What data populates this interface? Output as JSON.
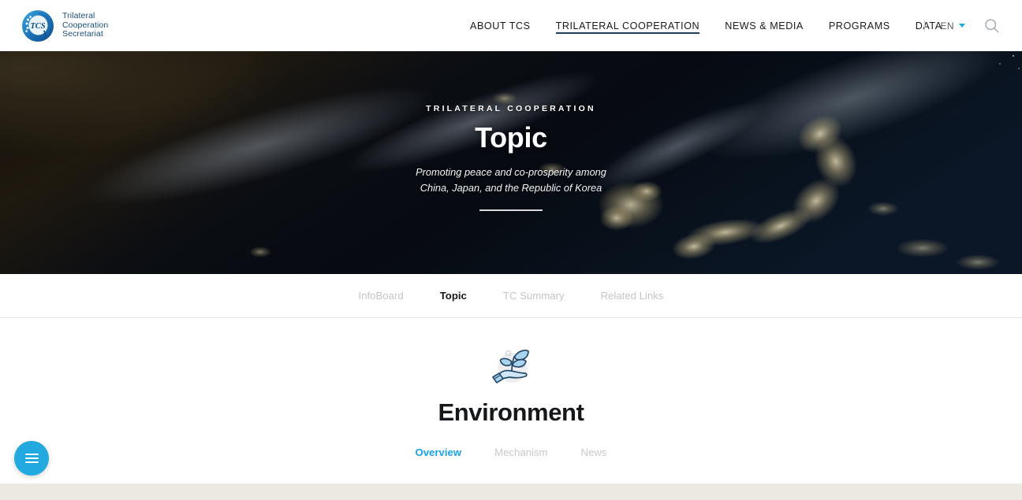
{
  "header": {
    "logo": {
      "icon": "tcs-globe-logo-icon",
      "line1": "Trilateral",
      "line2": "Cooperation",
      "line3": "Secretariat",
      "mark_text": "TCS"
    },
    "nav": [
      {
        "label": "ABOUT TCS",
        "active": false
      },
      {
        "label": "TRILATERAL COOPERATION",
        "active": true
      },
      {
        "label": "NEWS & MEDIA",
        "active": false
      },
      {
        "label": "PROGRAMS",
        "active": false
      },
      {
        "label": "DATA",
        "active": false
      }
    ],
    "language": {
      "label": "EN",
      "caret_icon": "chevron-down-icon"
    },
    "search": {
      "icon": "search-icon"
    },
    "accent_color": "#1aa9e0",
    "active_underline_color": "#1f3d5c"
  },
  "hero": {
    "eyebrow": "TRILATERAL COOPERATION",
    "title": "Topic",
    "subtitle_line1": "Promoting peace and co-prosperity among",
    "subtitle_line2": "China, Japan, and the Republic of Korea",
    "background": "earth-at-night-satellite-image"
  },
  "subnav": [
    {
      "label": "InfoBoard",
      "active": false
    },
    {
      "label": "Topic",
      "active": true
    },
    {
      "label": "TC Summary",
      "active": false
    },
    {
      "label": "Related Links",
      "active": false
    }
  ],
  "main": {
    "icon": "hand-holding-plant-icon",
    "title": "Environment",
    "tabs": [
      {
        "label": "Overview",
        "active": true
      },
      {
        "label": "Mechanism",
        "active": false
      },
      {
        "label": "News",
        "active": false
      }
    ],
    "active_tab_color": "#1aa3e8"
  },
  "fab": {
    "icon": "hamburger-menu-icon",
    "color": "#22a9e0"
  },
  "footer_strip": {
    "color": "#ebe9e0"
  }
}
